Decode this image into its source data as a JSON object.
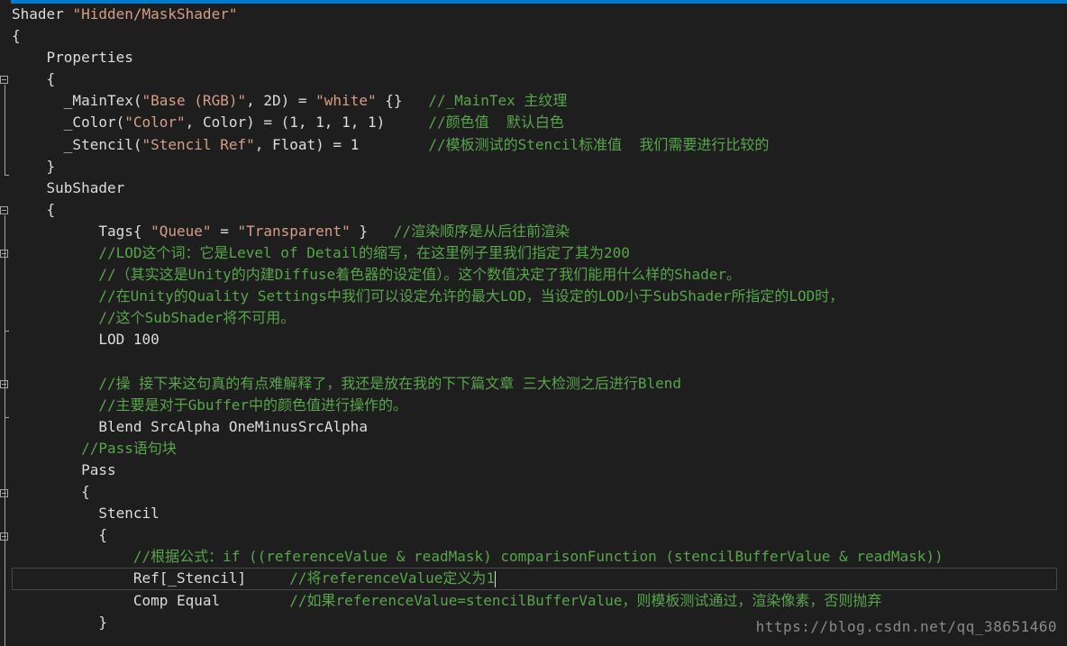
{
  "editor": {
    "lines": [
      [
        {
          "t": "Shader ",
          "c": "k"
        },
        {
          "t": "\"Hidden/MaskShader\"",
          "c": "s"
        }
      ],
      [
        {
          "t": "{",
          "c": "k"
        }
      ],
      [
        {
          "t": "    Properties",
          "c": "k"
        }
      ],
      [
        {
          "t": "    {",
          "c": "k"
        }
      ],
      [
        {
          "t": "      _MainTex(",
          "c": "k"
        },
        {
          "t": "\"Base (RGB)\"",
          "c": "s"
        },
        {
          "t": ", 2D) = ",
          "c": "k"
        },
        {
          "t": "\"white\"",
          "c": "s"
        },
        {
          "t": " {}   ",
          "c": "k"
        },
        {
          "t": "//_MainTex 主纹理",
          "c": "c"
        }
      ],
      [
        {
          "t": "      _Color(",
          "c": "k"
        },
        {
          "t": "\"Color\"",
          "c": "s"
        },
        {
          "t": ", Color) = (1, 1, 1, 1)     ",
          "c": "k"
        },
        {
          "t": "//颜色值  默认白色",
          "c": "c"
        }
      ],
      [
        {
          "t": "      _Stencil(",
          "c": "k"
        },
        {
          "t": "\"Stencil Ref\"",
          "c": "s"
        },
        {
          "t": ", Float) = 1        ",
          "c": "k"
        },
        {
          "t": "//模板测试的Stencil标准值  我们需要进行比较的",
          "c": "c"
        }
      ],
      [
        {
          "t": "    }",
          "c": "k"
        }
      ],
      [
        {
          "t": "    SubShader",
          "c": "k"
        }
      ],
      [
        {
          "t": "    {",
          "c": "k"
        }
      ],
      [
        {
          "t": "          Tags{ ",
          "c": "k"
        },
        {
          "t": "\"Queue\"",
          "c": "s"
        },
        {
          "t": " = ",
          "c": "k"
        },
        {
          "t": "\"Transparent\"",
          "c": "s"
        },
        {
          "t": " }   ",
          "c": "k"
        },
        {
          "t": "//渲染顺序是从后往前渲染",
          "c": "c"
        }
      ],
      [
        {
          "t": "          //LOD这个词：它是Level of Detail的缩写，在这里例子里我们指定了其为200",
          "c": "c"
        }
      ],
      [
        {
          "t": "          //（其实这是Unity的内建Diffuse着色器的设定值）。这个数值决定了我们能用什么样的Shader。",
          "c": "c"
        }
      ],
      [
        {
          "t": "          //在Unity的Quality Settings中我们可以设定允许的最大LOD，当设定的LOD小于SubShader所指定的LOD时，",
          "c": "c"
        }
      ],
      [
        {
          "t": "          //这个SubShader将不可用。",
          "c": "c"
        }
      ],
      [
        {
          "t": "          LOD 100",
          "c": "k"
        }
      ],
      [
        {
          "t": "",
          "c": "k"
        }
      ],
      [
        {
          "t": "          //操 接下来这句真的有点难解释了，我还是放在我的下下篇文章 三大检测之后进行Blend",
          "c": "c"
        }
      ],
      [
        {
          "t": "          //主要是对于Gbuffer中的颜色值进行操作的。",
          "c": "c"
        }
      ],
      [
        {
          "t": "          Blend SrcAlpha OneMinusSrcAlpha",
          "c": "k"
        }
      ],
      [
        {
          "t": "        //Pass语句块",
          "c": "c"
        }
      ],
      [
        {
          "t": "        Pass",
          "c": "k"
        }
      ],
      [
        {
          "t": "        {",
          "c": "k"
        }
      ],
      [
        {
          "t": "          Stencil",
          "c": "k"
        }
      ],
      [
        {
          "t": "          {",
          "c": "k"
        }
      ],
      [
        {
          "t": "              //根据公式：if ((referenceValue & readMask) comparisonFunction (stencilBufferValue & readMask))",
          "c": "c"
        }
      ],
      [
        {
          "t": "              Ref[_Stencil]     ",
          "c": "k"
        },
        {
          "t": "//将referenceValue定义为1",
          "c": "c"
        }
      ],
      [
        {
          "t": "              Comp Equal        ",
          "c": "k"
        },
        {
          "t": "//如果referenceValue=stencilBufferValue，则模板测试通过，渲染像素，否则抛弃",
          "c": "c"
        }
      ],
      [
        {
          "t": "          }",
          "c": "k"
        }
      ]
    ],
    "current_line": 26
  },
  "watermark": "https://blog.csdn.net/qq_38651460"
}
